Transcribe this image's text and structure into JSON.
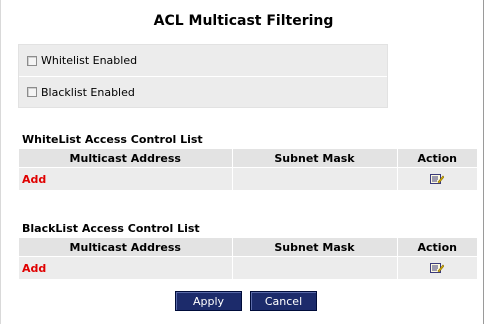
{
  "title": "ACL Multicast Filtering",
  "options": {
    "whitelist_label": "Whitelist Enabled",
    "blacklist_label": "Blacklist Enabled"
  },
  "whitelist": {
    "title": "WhiteList Access Control List",
    "columns": [
      "Multicast Address",
      "Subnet Mask",
      "Action"
    ],
    "add_label": "Add"
  },
  "blacklist": {
    "title": "BlackList Access Control List",
    "columns": [
      "Multicast Address",
      "Subnet Mask",
      "Action"
    ],
    "add_label": "Add"
  },
  "buttons": {
    "apply": "Apply",
    "cancel": "Cancel"
  },
  "icons": {
    "action": "edit-icon"
  }
}
